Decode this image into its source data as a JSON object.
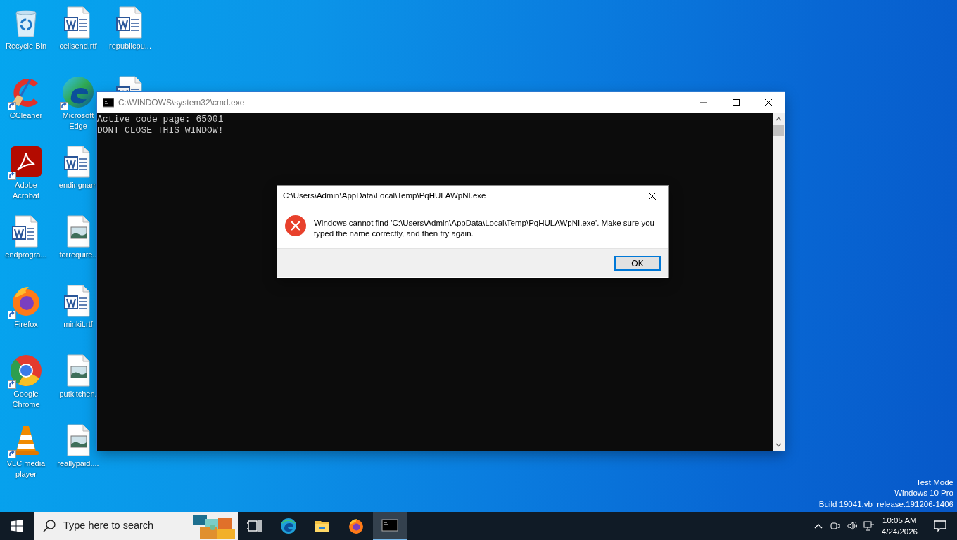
{
  "desktop": {
    "columns": [
      [
        {
          "kind": "recycle-bin",
          "label": "Recycle Bin",
          "shortcut": false
        },
        {
          "kind": "ccleaner",
          "label": "CCleaner",
          "shortcut": true
        },
        {
          "kind": "acrobat",
          "label": "Adobe Acrobat",
          "shortcut": true
        },
        {
          "kind": "word",
          "label": "endprogra...",
          "shortcut": false
        },
        {
          "kind": "firefox",
          "label": "Firefox",
          "shortcut": true
        },
        {
          "kind": "chrome",
          "label": "Google Chrome",
          "shortcut": true
        },
        {
          "kind": "vlc",
          "label": "VLC media player",
          "shortcut": true
        }
      ],
      [
        {
          "kind": "word",
          "label": "cellsend.rtf",
          "shortcut": false
        },
        {
          "kind": "edge",
          "label": "Microsoft Edge",
          "shortcut": true
        },
        {
          "kind": "word",
          "label": "endingnam",
          "shortcut": false
        },
        {
          "kind": "image",
          "label": "forrequire..",
          "shortcut": false
        },
        {
          "kind": "word",
          "label": "minkit.rtf",
          "shortcut": false
        },
        {
          "kind": "image",
          "label": "putkitchen.",
          "shortcut": false
        },
        {
          "kind": "image",
          "label": "reallypaid....",
          "shortcut": false
        }
      ],
      [
        {
          "kind": "word",
          "label": "republicpu...",
          "shortcut": false
        },
        {
          "kind": "word",
          "shortcut": false
        }
      ]
    ]
  },
  "console": {
    "title": "C:\\WINDOWS\\system32\\cmd.exe",
    "lines": [
      "Active code page: 65001",
      "DONT CLOSE THIS WINDOW!"
    ]
  },
  "dialog": {
    "title": "C:\\Users\\Admin\\AppData\\Local\\Temp\\PqHULAWpNI.exe",
    "kind": "error",
    "message": "Windows cannot find 'C:\\Users\\Admin\\AppData\\Local\\Temp\\PqHULAWpNI.exe'. Make sure you typed the name correctly, and then try again.",
    "buttons": [
      {
        "label": "OK",
        "default": true
      }
    ]
  },
  "system_text": [
    "Test Mode",
    "Windows 10 Pro",
    "Build 19041.vb_release.191206-1406"
  ],
  "taskbar": {
    "search": {
      "placeholder": "Type here to search"
    },
    "apps": [
      {
        "kind": "task-view",
        "active": false
      },
      {
        "kind": "edge",
        "active": false
      },
      {
        "kind": "explorer",
        "active": false
      },
      {
        "kind": "firefox",
        "active": false
      },
      {
        "kind": "cmd",
        "active": true
      }
    ],
    "tray": {
      "time": "10:05 AM",
      "date": "4/24/2026"
    }
  }
}
